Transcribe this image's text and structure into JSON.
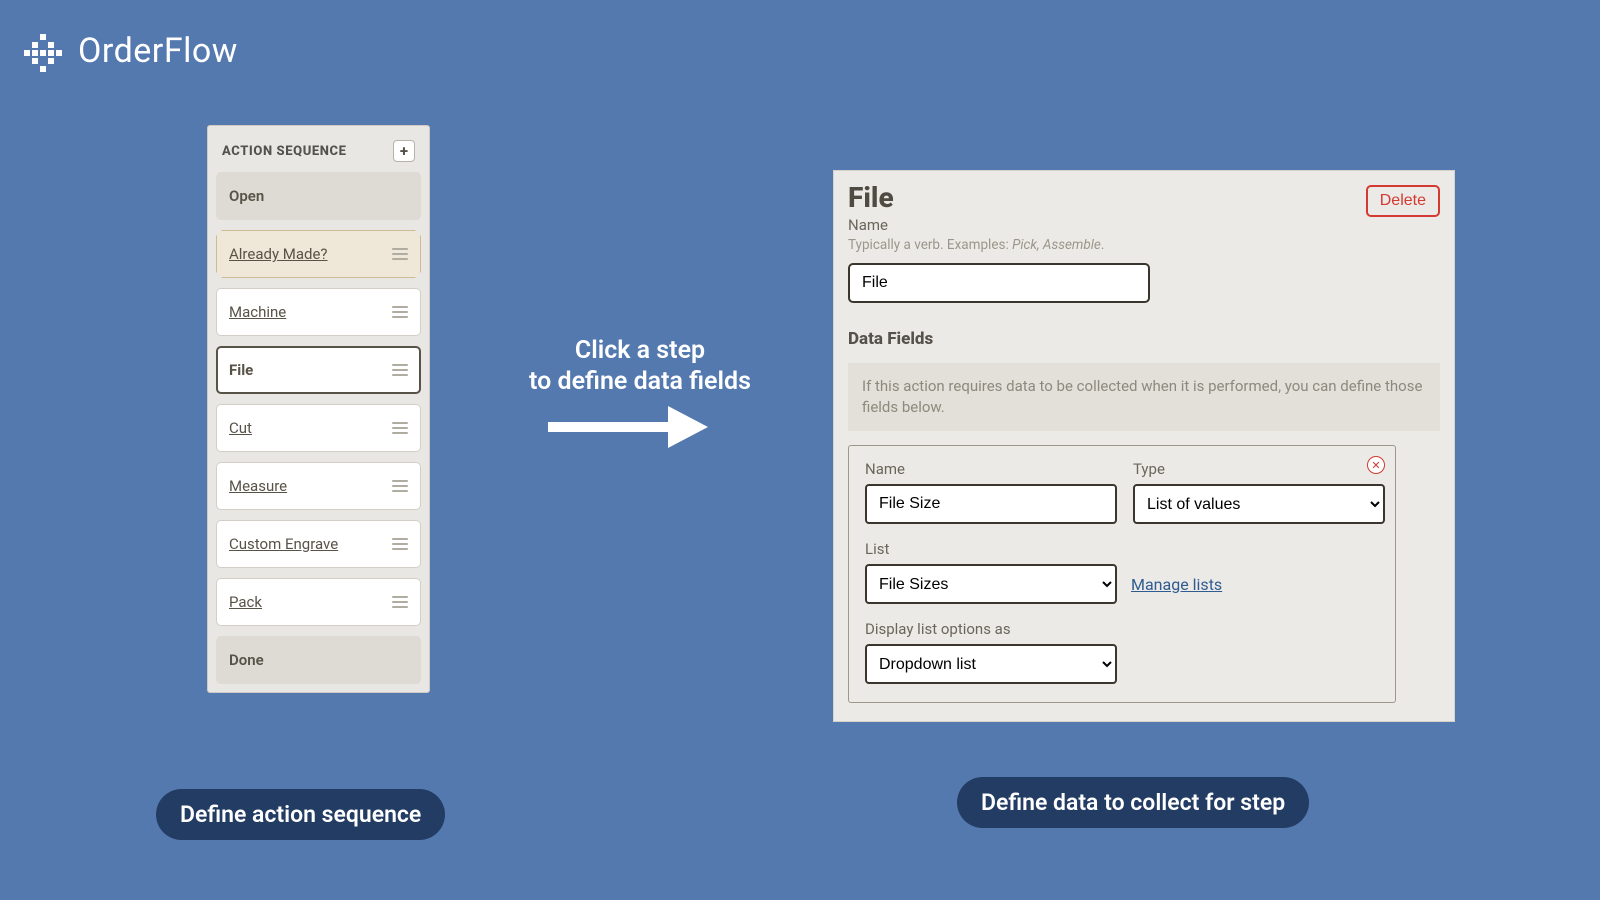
{
  "brand": {
    "name": "OrderFlow"
  },
  "sequence": {
    "title": "ACTION SEQUENCE",
    "add_label": "+",
    "items": [
      {
        "label": "Open",
        "kind": "terminal"
      },
      {
        "label": "Already Made?",
        "kind": "branching"
      },
      {
        "label": "Machine",
        "kind": "step"
      },
      {
        "label": "File",
        "kind": "selected"
      },
      {
        "label": "Cut",
        "kind": "step"
      },
      {
        "label": "Measure",
        "kind": "step"
      },
      {
        "label": "Custom Engrave",
        "kind": "step"
      },
      {
        "label": "Pack",
        "kind": "step"
      },
      {
        "label": "Done",
        "kind": "terminal"
      }
    ]
  },
  "annotation": {
    "line1": "Click a step",
    "line2": "to define data fields"
  },
  "detail": {
    "title": "File",
    "delete_label": "Delete",
    "name_label": "Name",
    "name_hint_prefix": "Typically a verb. Examples: ",
    "name_hint_examples": "Pick, Assemble",
    "name_hint_suffix": ".",
    "name_value": "File",
    "data_fields_head": "Data Fields",
    "info_text": "If this action requires data to be collected when it is performed, you can define those fields below.",
    "field": {
      "name_label": "Name",
      "name_value": "File Size",
      "type_label": "Type",
      "type_value": "List of values",
      "list_label": "List",
      "list_value": "File Sizes",
      "manage_label": "Manage lists",
      "display_label": "Display list options as",
      "display_value": "Dropdown list"
    }
  },
  "captions": {
    "left": "Define action sequence",
    "right": "Define data to collect for step"
  }
}
